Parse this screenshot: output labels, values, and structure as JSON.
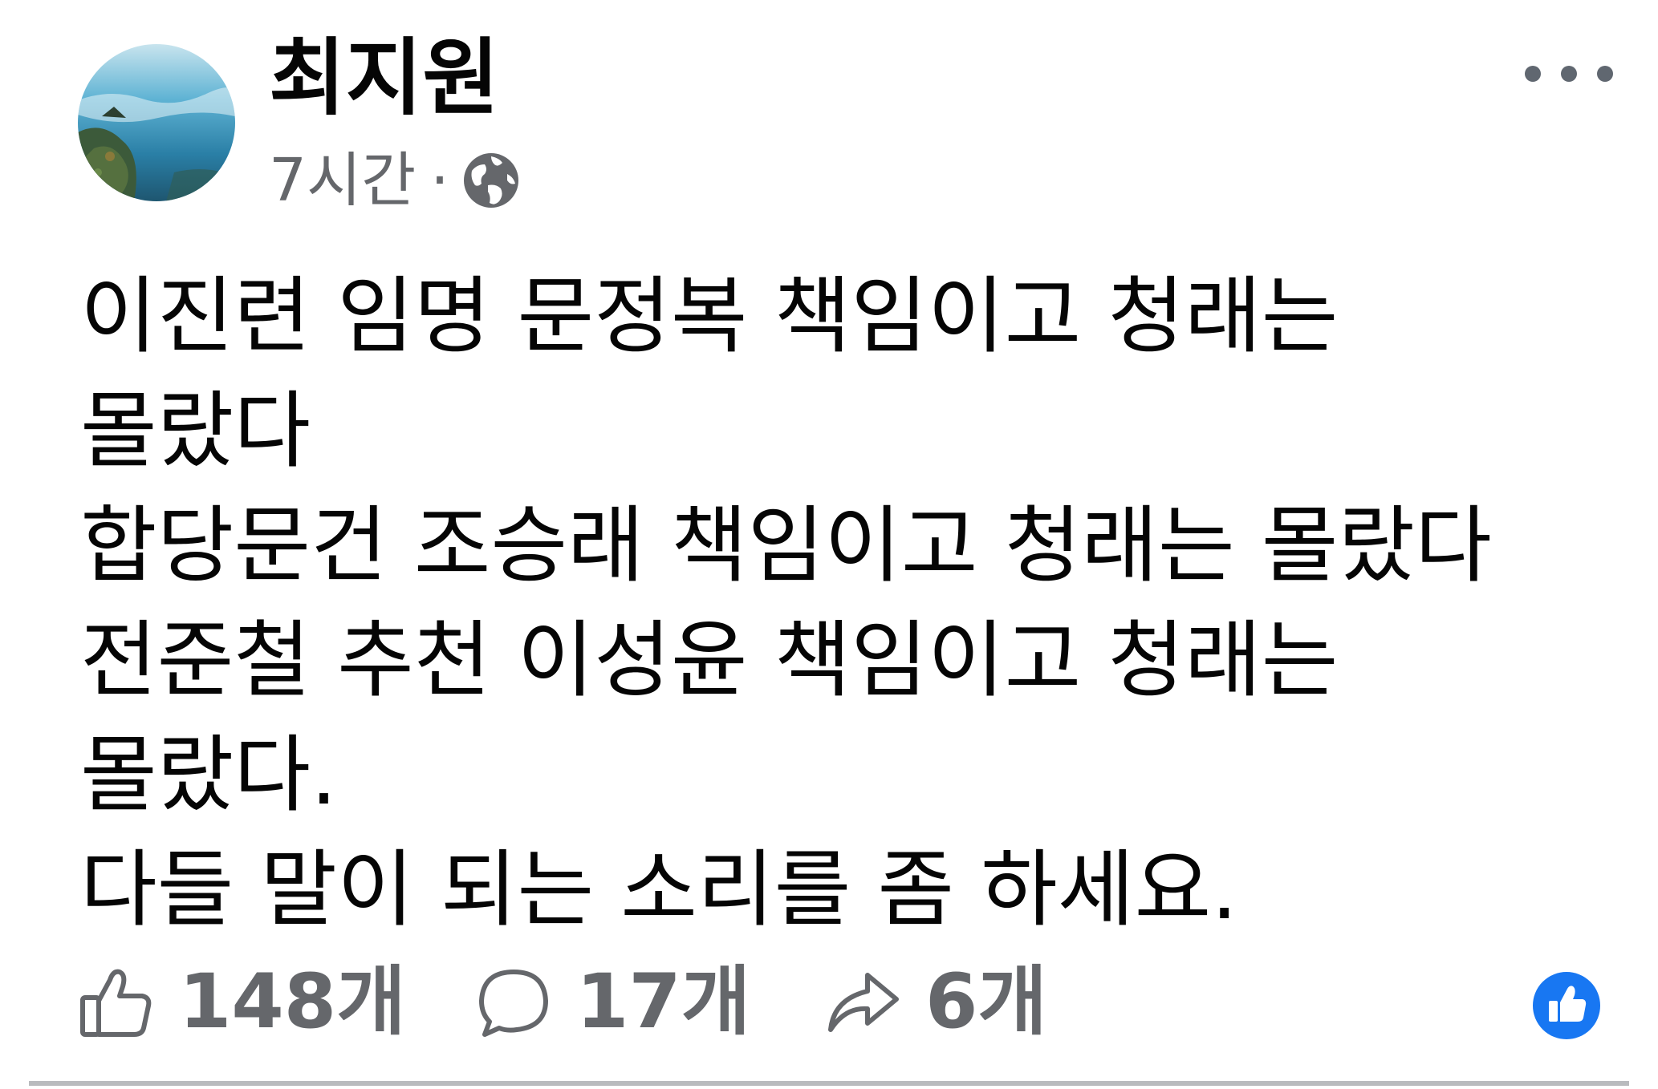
{
  "post": {
    "author": "최지원",
    "time": "7시간",
    "separator": "·",
    "audience_icon": "globe-icon",
    "more_icon": "more-options-icon",
    "body_lines": [
      "이진련 임명 문정복 책임이고 청래는",
      "몰랐다",
      "합당문건 조승래 책임이고 청래는 몰랐다",
      "전준철 추천 이성윤 책임이고 청래는",
      "몰랐다.",
      "다들 말이 되는 소리를 좀 하세요."
    ],
    "actions": {
      "like": {
        "icon": "thumbs-up-icon",
        "count": "148개"
      },
      "comment": {
        "icon": "comment-bubble-icon",
        "count": "17개"
      },
      "share": {
        "icon": "share-arrow-icon",
        "count": "6개"
      }
    },
    "reaction_badge_icon": "like-reaction-icon"
  },
  "colors": {
    "text_primary": "#050505",
    "text_secondary": "#65676b",
    "facebook_blue": "#1877f2",
    "divider": "#b9bbbe"
  }
}
